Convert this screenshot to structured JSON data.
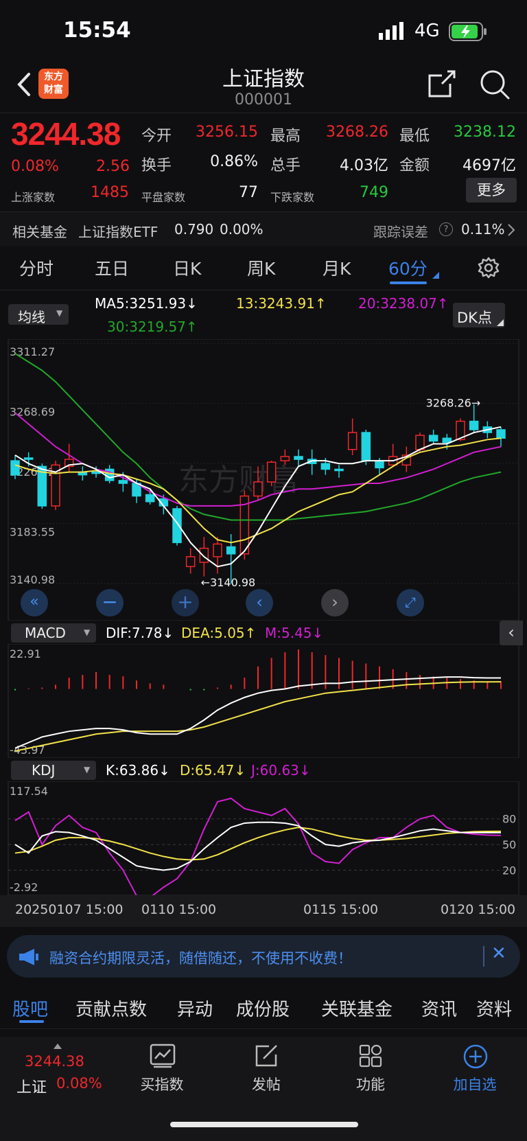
{
  "status_bar": {
    "time": "15:54",
    "network": "4G"
  },
  "header": {
    "logo_text_1": "东方",
    "logo_text_2": "财富",
    "title": "上证指数",
    "code": "000001"
  },
  "quote": {
    "price": "3244.38",
    "change_pct": "0.08%",
    "change": "2.56",
    "open_label": "今开",
    "open": "3256.15",
    "high_label": "最高",
    "high": "3268.26",
    "low_label": "最低",
    "low": "3238.12",
    "turnover_label": "换手",
    "turnover": "0.86%",
    "volume_label": "总手",
    "volume": "4.03亿",
    "amount_label": "金额",
    "amount": "4697亿",
    "up_label": "上涨家数",
    "up_count": "1485",
    "flat_label": "平盘家数",
    "flat_count": "77",
    "down_label": "下跌家数",
    "down_count": "749",
    "more_label": "更多"
  },
  "fund": {
    "label": "相关基金",
    "name": "上证指数ETF",
    "price": "0.790",
    "pct": "0.00%",
    "tracking_label": "跟踪误差",
    "tracking_value": "0.11%"
  },
  "period_tabs": [
    "分时",
    "五日",
    "日K",
    "周K",
    "月K",
    "60分"
  ],
  "main_chart": {
    "ma_selector": "均线",
    "ma5": "MA5:3251.93",
    "ma13": "13:3243.91",
    "ma20": "20:3238.07",
    "ma30": "30:3219.57",
    "dk_button": "DK点",
    "y_labels": [
      "3311.27",
      "3268.69",
      "3226.12",
      "3183.55",
      "3140.98"
    ],
    "high_marker": "3268.26",
    "low_marker": "3140.98",
    "watermark": "东方财富"
  },
  "macd": {
    "selector": "MACD",
    "dif": "DIF:7.78",
    "dea": "DEA:5.05",
    "m": "M:5.45",
    "ymax": "22.91",
    "ymin": "-43.97"
  },
  "kdj": {
    "selector": "KDJ",
    "k": "K:63.86",
    "d": "D:65.47",
    "j": "J:60.63",
    "ymax": "117.54",
    "ymin": "-2.92",
    "levels": [
      "80",
      "50",
      "20"
    ]
  },
  "x_axis": [
    "20250107 15:00",
    "0110 15:00",
    "0115 15:00",
    "0120 15:00"
  ],
  "notice": {
    "text": "融资合约期限灵活，随借随还，不使用不收费！"
  },
  "bottom_tabs": [
    "股吧",
    "贡献点数",
    "异动",
    "成份股",
    "关联基金",
    "资讯",
    "资料"
  ],
  "bottom_nav": {
    "index_price": "3244.38",
    "index_name": "上证",
    "index_pct": "0.08%",
    "buy_label": "买指数",
    "post_label": "发帖",
    "func_label": "功能",
    "add_label": "加自选"
  },
  "colors": {
    "up": "#f0272b",
    "down": "#22d3e0",
    "ma5": "#ffffff",
    "ma13": "#f2e24a",
    "ma20": "#d21fd2",
    "ma30": "#22a82a",
    "accent": "#3b82e8"
  },
  "chart_data": {
    "type": "candlestick",
    "title": "",
    "candles": [
      {
        "o": 3228,
        "c": 3218,
        "h": 3232,
        "l": 3215
      },
      {
        "o": 3230,
        "c": 3229,
        "h": 3234,
        "l": 3224
      },
      {
        "o": 3224,
        "c": 3196,
        "h": 3226,
        "l": 3194
      },
      {
        "o": 3196,
        "c": 3225,
        "h": 3228,
        "l": 3193
      },
      {
        "o": 3224,
        "c": 3229,
        "h": 3240,
        "l": 3220
      },
      {
        "o": 3220,
        "c": 3218,
        "h": 3224,
        "l": 3214
      },
      {
        "o": 3220,
        "c": 3219,
        "h": 3224,
        "l": 3216
      },
      {
        "o": 3222,
        "c": 3214,
        "h": 3225,
        "l": 3212
      },
      {
        "o": 3214,
        "c": 3212,
        "h": 3220,
        "l": 3206
      },
      {
        "o": 3212,
        "c": 3203,
        "h": 3215,
        "l": 3198
      },
      {
        "o": 3204,
        "c": 3199,
        "h": 3208,
        "l": 3197
      },
      {
        "o": 3201,
        "c": 3196,
        "h": 3204,
        "l": 3190
      },
      {
        "o": 3194,
        "c": 3170,
        "h": 3196,
        "l": 3168
      },
      {
        "o": 3153,
        "c": 3160,
        "h": 3166,
        "l": 3148
      },
      {
        "o": 3156,
        "c": 3166,
        "h": 3174,
        "l": 3146
      },
      {
        "o": 3160,
        "c": 3169,
        "h": 3174,
        "l": 3148
      },
      {
        "o": 3167,
        "c": 3162,
        "h": 3176,
        "l": 3141
      },
      {
        "o": 3162,
        "c": 3203,
        "h": 3207,
        "l": 3158
      },
      {
        "o": 3203,
        "c": 3213,
        "h": 3224,
        "l": 3200
      },
      {
        "o": 3213,
        "c": 3227,
        "h": 3228,
        "l": 3210
      },
      {
        "o": 3228,
        "c": 3231,
        "h": 3236,
        "l": 3225
      },
      {
        "o": 3231,
        "c": 3229,
        "h": 3236,
        "l": 3224
      },
      {
        "o": 3229,
        "c": 3226,
        "h": 3236,
        "l": 3218
      },
      {
        "o": 3226,
        "c": 3222,
        "h": 3230,
        "l": 3218
      },
      {
        "o": 3222,
        "c": 3221,
        "h": 3225,
        "l": 3216
      },
      {
        "o": 3236,
        "c": 3248,
        "h": 3258,
        "l": 3232
      },
      {
        "o": 3248,
        "c": 3228,
        "h": 3250,
        "l": 3225
      },
      {
        "o": 3228,
        "c": 3223,
        "h": 3230,
        "l": 3218
      },
      {
        "o": 3225,
        "c": 3231,
        "h": 3240,
        "l": 3224
      },
      {
        "o": 3225,
        "c": 3232,
        "h": 3238,
        "l": 3220
      },
      {
        "o": 3236,
        "c": 3246,
        "h": 3248,
        "l": 3234
      },
      {
        "o": 3246,
        "c": 3242,
        "h": 3250,
        "l": 3240
      },
      {
        "o": 3244,
        "c": 3241,
        "h": 3247,
        "l": 3236
      },
      {
        "o": 3243,
        "c": 3256,
        "h": 3258,
        "l": 3242
      },
      {
        "o": 3256,
        "c": 3250,
        "h": 3268,
        "l": 3248
      },
      {
        "o": 3252,
        "c": 3248,
        "h": 3256,
        "l": 3244
      },
      {
        "o": 3250,
        "c": 3244,
        "h": 3252,
        "l": 3238
      }
    ],
    "ma5": [
      3232,
      3226,
      3222,
      3220,
      3225,
      3226,
      3222,
      3216,
      3218,
      3212,
      3208,
      3196,
      3184,
      3170,
      3160,
      3153,
      3155,
      3164,
      3178,
      3194,
      3210,
      3224,
      3228,
      3228,
      3226,
      3226,
      3228,
      3228,
      3228,
      3231,
      3236,
      3240,
      3240,
      3244,
      3248,
      3250,
      3252
    ],
    "ma13": [
      3225,
      3222,
      3220,
      3219,
      3220,
      3220,
      3221,
      3219,
      3218,
      3215,
      3212,
      3208,
      3200,
      3190,
      3180,
      3172,
      3170,
      3172,
      3176,
      3180,
      3186,
      3192,
      3196,
      3200,
      3204,
      3206,
      3212,
      3218,
      3224,
      3230,
      3234,
      3236,
      3238,
      3239,
      3241,
      3243,
      3244
    ],
    "ma20": [
      3262,
      3254,
      3246,
      3238,
      3232,
      3226,
      3222,
      3220,
      3216,
      3212,
      3206,
      3202,
      3198,
      3196,
      3196,
      3196,
      3196,
      3197,
      3200,
      3204,
      3206,
      3208,
      3208,
      3209,
      3210,
      3211,
      3212,
      3212,
      3214,
      3216,
      3219,
      3222,
      3226,
      3230,
      3234,
      3236,
      3238
    ],
    "ma30": [
      3304,
      3298,
      3292,
      3284,
      3274,
      3264,
      3254,
      3244,
      3234,
      3226,
      3216,
      3208,
      3200,
      3194,
      3190,
      3188,
      3186,
      3186,
      3186,
      3186,
      3186,
      3187,
      3188,
      3189,
      3190,
      3191,
      3192,
      3194,
      3196,
      3198,
      3201,
      3205,
      3209,
      3213,
      3216,
      3218,
      3220
    ],
    "macd_hist": [
      -1,
      0.5,
      1,
      3,
      8,
      10,
      12,
      10,
      9,
      6,
      4,
      3,
      0,
      -1,
      -1,
      1,
      3,
      8,
      16,
      22,
      26,
      28,
      26,
      24,
      22,
      20,
      18,
      16,
      14,
      12,
      10,
      9,
      8,
      7,
      6,
      5.5,
      5.45
    ],
    "dif": [
      -42,
      -38,
      -34,
      -32,
      -30,
      -29,
      -28,
      -28,
      -29,
      -31,
      -32,
      -32,
      -32,
      -28,
      -22,
      -15,
      -10,
      -6,
      -3,
      -1,
      0,
      2,
      3,
      4,
      4,
      5,
      5.5,
      6,
      6.5,
      7,
      7.5,
      8,
      8.5,
      8.5,
      8,
      7.8,
      7.78
    ],
    "dea": [
      -44,
      -42,
      -40,
      -38,
      -36,
      -34,
      -32,
      -31,
      -30,
      -30,
      -30,
      -30,
      -30,
      -29,
      -27,
      -24,
      -21,
      -18,
      -15,
      -12,
      -9,
      -7,
      -5,
      -3,
      -2,
      -1,
      0,
      1,
      2,
      3,
      3.5,
      4,
      4.5,
      4.8,
      5,
      5.02,
      5.05
    ],
    "kdj_k": [
      50,
      40,
      60,
      65,
      64,
      60,
      55,
      45,
      35,
      25,
      22,
      20,
      22,
      30,
      45,
      58,
      70,
      75,
      76,
      76,
      75,
      72,
      60,
      50,
      48,
      52,
      54,
      55,
      58,
      62,
      66,
      68,
      66,
      64,
      63.9,
      63.88,
      63.86
    ],
    "kdj_d": [
      40,
      42,
      48,
      55,
      58,
      58,
      57,
      54,
      50,
      45,
      40,
      36,
      33,
      32,
      33,
      38,
      45,
      52,
      58,
      63,
      67,
      70,
      68,
      64,
      60,
      57,
      55,
      55,
      56,
      57,
      59,
      61,
      63,
      64,
      65,
      65.3,
      65.47
    ],
    "kdj_j": [
      78,
      88,
      50,
      72,
      84,
      70,
      64,
      40,
      20,
      -10,
      -12,
      0,
      10,
      30,
      68,
      100,
      104,
      92,
      88,
      84,
      92,
      74,
      40,
      30,
      28,
      44,
      52,
      58,
      58,
      70,
      80,
      84,
      70,
      64,
      62,
      61,
      60.63
    ]
  }
}
